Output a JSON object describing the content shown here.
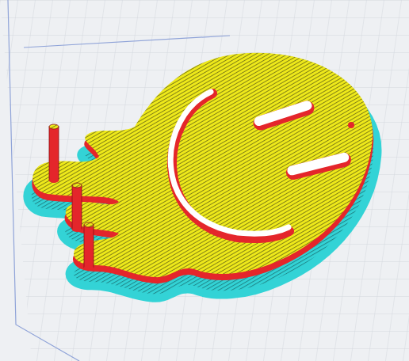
{
  "viewport": {
    "model": "melting smiley layer preview"
  },
  "features": [
    {
      "name": "skirt",
      "color": "#33d3d6"
    },
    {
      "name": "wall",
      "color": "#e4262b"
    },
    {
      "name": "infill",
      "color": "#eee91a"
    },
    {
      "name": "support",
      "color": "#e4262b"
    }
  ],
  "pins": [
    {
      "kind": "pillar"
    },
    {
      "kind": "pillar"
    },
    {
      "kind": "pillar"
    }
  ]
}
